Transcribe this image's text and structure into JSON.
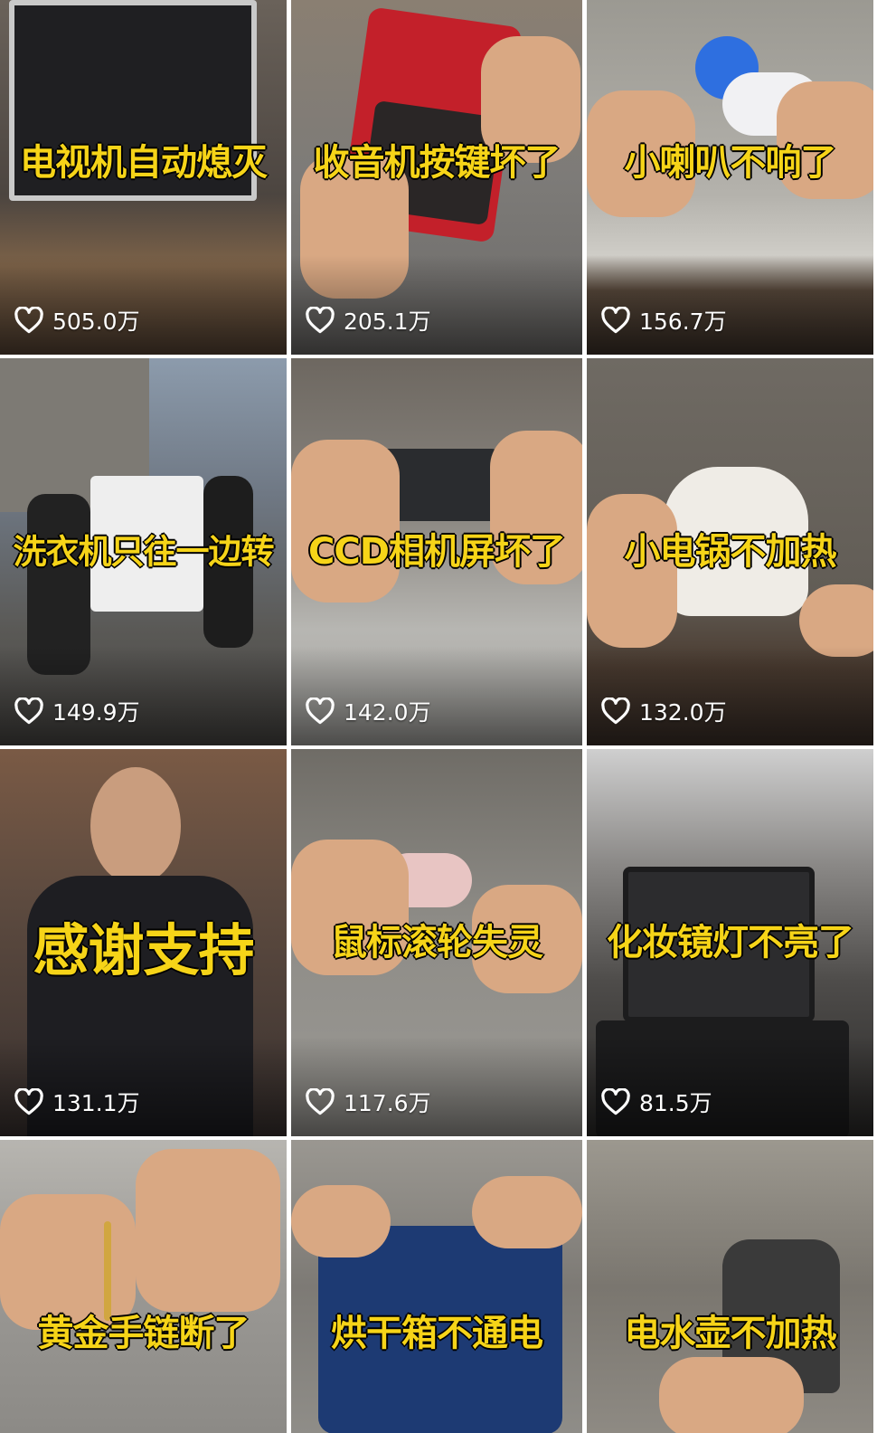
{
  "tiles": [
    {
      "caption": "电视机自动熄灭",
      "likes": "505.0万",
      "bg": "#5a5148",
      "accent": "#2d2a28",
      "surface": "#8a6e55"
    },
    {
      "caption": "收音机按键坏了",
      "likes": "205.1万",
      "bg": "#7f7f7c",
      "accent": "#c3202a",
      "surface": "#6a6866"
    },
    {
      "caption": "小喇叭不响了",
      "likes": "156.7万",
      "bg": "#a7a59f",
      "accent": "#2e6fe0",
      "surface": "#5b4b3d"
    },
    {
      "caption": "洗衣机只往一边转",
      "likes": "149.9万",
      "bg": "#6e7884",
      "accent": "#e9e9e9",
      "surface": "#55524d"
    },
    {
      "caption": "CCD相机屏坏了",
      "likes": "142.0万",
      "bg": "#8d8b86",
      "accent": "#2a2c2f",
      "surface": "#b7b6b2"
    },
    {
      "caption": "小电锅不加热",
      "likes": "132.0万",
      "bg": "#6b655d",
      "accent": "#efece6",
      "surface": "#4a3b30"
    },
    {
      "caption": "感谢支持",
      "likes": "131.1万",
      "bg": "#5c4a3f",
      "accent": "#1e1e22",
      "surface": "#3a3230"
    },
    {
      "caption": "鼠标滚轮失灵",
      "likes": "117.6万",
      "bg": "#8e8c87",
      "accent": "#e8c5c3",
      "surface": "#9b9994"
    },
    {
      "caption": "化妆镜灯不亮了",
      "likes": "81.5万",
      "bg": "#4e4c4a",
      "accent": "#1c1c1d",
      "surface": "#6a6764"
    },
    {
      "caption": "黄金手链断了",
      "likes": "",
      "bg": "#9a9894",
      "accent": "#d1a640",
      "surface": "#8c8a86"
    },
    {
      "caption": "烘干箱不通电",
      "likes": "",
      "bg": "#7d7a75",
      "accent": "#1d3a73",
      "surface": "#8f8d88"
    },
    {
      "caption": "电水壶不加热",
      "likes": "",
      "bg": "#7a766f",
      "accent": "#3a3a3a",
      "surface": "#8e8a83"
    }
  ],
  "icons": {
    "like": "heart-outline-icon"
  },
  "colors": {
    "caption_fill": "#f6d418",
    "caption_stroke": "#1a1a1a",
    "like_text": "#ffffff"
  }
}
